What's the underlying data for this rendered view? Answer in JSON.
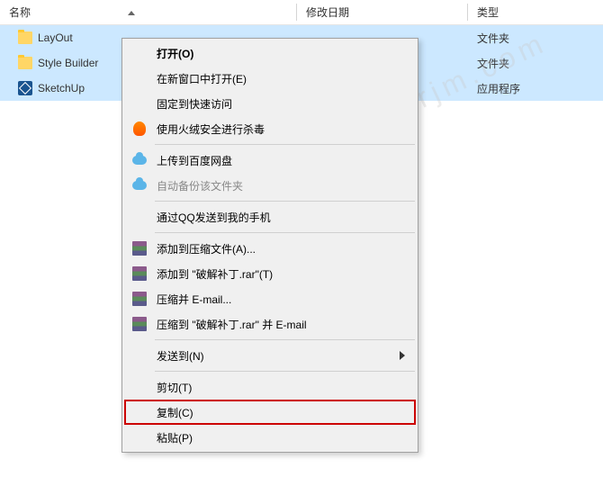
{
  "columns": {
    "name": "名称",
    "date": "修改日期",
    "type": "类型"
  },
  "files": [
    {
      "name": "LayOut",
      "type": "文件夹",
      "icon": "folder"
    },
    {
      "name": "Style Builder",
      "type": "文件夹",
      "icon": "folder"
    },
    {
      "name": "SketchUp",
      "type": "应用程序",
      "icon": "sketchup"
    }
  ],
  "menu": {
    "open": "打开(O)",
    "new_window": "在新窗口中打开(E)",
    "pin": "固定到快速访问",
    "scan": "使用火绒安全进行杀毒",
    "upload_baidu": "上传到百度网盘",
    "auto_backup": "自动备份该文件夹",
    "qq_send": "通过QQ发送到我的手机",
    "rar_add": "添加到压缩文件(A)...",
    "rar_add_named": "添加到 \"破解补丁.rar\"(T)",
    "rar_email": "压缩并 E-mail...",
    "rar_compress_email": "压缩到 \"破解补丁.rar\" 并 E-mail",
    "send_to": "发送到(N)",
    "cut": "剪切(T)",
    "copy": "复制(C)",
    "paste": "粘贴(P)"
  },
  "watermark": "www.xxrjm.com"
}
